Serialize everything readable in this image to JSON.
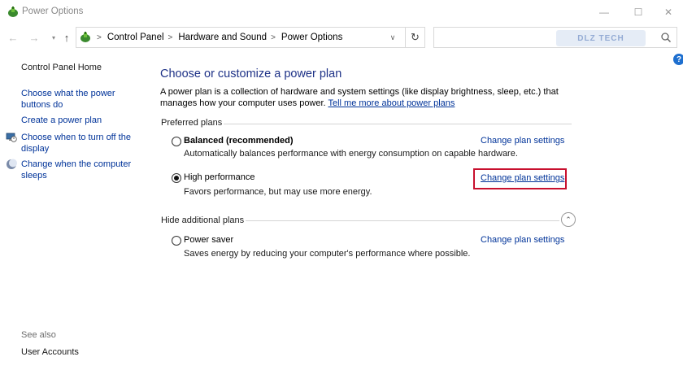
{
  "window": {
    "title": "Power Options",
    "minimize_glyph": "—",
    "maximize_glyph": "☐",
    "close_glyph": "✕"
  },
  "navigation": {
    "back_glyph": "←",
    "forward_glyph": "→",
    "dropdown_glyph": "▾",
    "up_glyph": "↑",
    "breadcrumbs": [
      "Control Panel",
      "Hardware and Sound",
      "Power Options"
    ],
    "crumb_separator": ">",
    "address_dropdown_glyph": "∨",
    "refresh_glyph": "↻",
    "search_placeholder": "",
    "watermark_text": "DLZ TECH"
  },
  "help_glyph": "?",
  "sidebar": {
    "home": "Control Panel Home",
    "items": [
      {
        "label": "Choose what the power buttons do",
        "icon": "none"
      },
      {
        "label": "Create a power plan",
        "icon": "none"
      },
      {
        "label": "Choose when to turn off the display",
        "icon": "monitor-clock-icon"
      },
      {
        "label": "Change when the computer sleeps",
        "icon": "moon-icon"
      }
    ],
    "see_also_heading": "See also",
    "see_also_items": [
      "User Accounts"
    ]
  },
  "main": {
    "title": "Choose or customize a power plan",
    "description": "A power plan is a collection of hardware and system settings (like display brightness, sleep, etc.) that manages how your computer uses power.",
    "description_link": "Tell me more about power plans",
    "preferred_heading": "Preferred plans",
    "hidden_heading": "Hide additional plans",
    "collapse_glyph": "⌃",
    "plans": [
      {
        "name": "Balanced (recommended)",
        "description": "Automatically balances performance with energy consumption on capable hardware.",
        "link": "Change plan settings",
        "selected": false
      },
      {
        "name": "High performance",
        "description": "Favors performance, but may use more energy.",
        "link": "Change plan settings",
        "selected": true
      },
      {
        "name": "Power saver",
        "description": "Saves energy by reducing your computer's performance where possible.",
        "link": "Change plan settings",
        "selected": false
      }
    ]
  },
  "colors": {
    "link": "#003399",
    "title": "#1e3287",
    "highlight": "#c8102e",
    "help": "#1e6fcf"
  }
}
